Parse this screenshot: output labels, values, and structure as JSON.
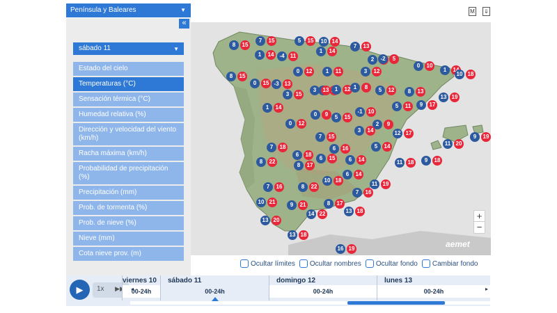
{
  "region_select": {
    "label": "Península y Baleares"
  },
  "collapse_label": "«",
  "day_select": {
    "label": "sábado 11"
  },
  "menu": [
    {
      "label": "Estado del cielo",
      "active": false
    },
    {
      "label": "Temperaturas (°C)",
      "active": true
    },
    {
      "label": "Sensación térmica (°C)",
      "active": false
    },
    {
      "label": "Humedad relativa (%)",
      "active": false
    },
    {
      "label": "Dirección y velocidad del viento (km/h)",
      "active": false
    },
    {
      "label": "Racha máxima (km/h)",
      "active": false
    },
    {
      "label": "Probabilidad de precipitación (%)",
      "active": false
    },
    {
      "label": "Precipitación (mm)",
      "active": false
    },
    {
      "label": "Prob. de tormenta (%)",
      "active": false
    },
    {
      "label": "Prob. de nieve (%)",
      "active": false
    },
    {
      "label": "Nieve (mm)",
      "active": false
    },
    {
      "label": "Cota nieve prov. (m)",
      "active": false
    }
  ],
  "top_icons": {
    "m_label": "M",
    "download_label": "⇓"
  },
  "map": {
    "colors": {
      "min": "#2d5a9f",
      "max": "#e8283a"
    },
    "logo": "aemet",
    "zoom_in": "+",
    "zoom_out": "−",
    "pairs": [
      {
        "min": "8",
        "max": "15"
      },
      {
        "min": "7",
        "max": "15"
      },
      {
        "min": "5",
        "max": "15"
      },
      {
        "min": "10",
        "max": "14"
      },
      {
        "min": "7",
        "max": "13"
      },
      {
        "min": "1",
        "max": "14"
      },
      {
        "min": "-4",
        "max": "11"
      },
      {
        "min": "1",
        "max": "14"
      },
      {
        "min": "2",
        "max": "10"
      },
      {
        "min": "-2",
        "max": "5"
      },
      {
        "min": "0",
        "max": "10"
      },
      {
        "min": "8",
        "max": "15"
      },
      {
        "min": "0",
        "max": "12"
      },
      {
        "min": "1",
        "max": "11"
      },
      {
        "min": "3",
        "max": "12"
      },
      {
        "min": "1",
        "max": "14"
      },
      {
        "min": "10",
        "max": "18"
      },
      {
        "min": "0",
        "max": "15"
      },
      {
        "min": "-3",
        "max": "13"
      },
      {
        "min": "6",
        "max": "13"
      },
      {
        "min": "3",
        "max": "15"
      },
      {
        "min": "3",
        "max": "13"
      },
      {
        "min": "1",
        "max": "12"
      },
      {
        "min": "1",
        "max": "8"
      },
      {
        "min": "5",
        "max": "12"
      },
      {
        "min": "8",
        "max": "13"
      },
      {
        "min": "13",
        "max": "19"
      },
      {
        "min": "1",
        "max": "14"
      },
      {
        "min": "5",
        "max": "11"
      },
      {
        "min": "9",
        "max": "17"
      },
      {
        "min": "0",
        "max": "9"
      },
      {
        "min": "5",
        "max": "15"
      },
      {
        "min": "-1",
        "max": "10"
      },
      {
        "min": "0",
        "max": "12"
      },
      {
        "min": "2",
        "max": "9"
      },
      {
        "min": "3",
        "max": "14"
      },
      {
        "min": "12",
        "max": "17"
      },
      {
        "min": "9",
        "max": "19"
      },
      {
        "min": "7",
        "max": "15"
      },
      {
        "min": "11",
        "max": "20"
      },
      {
        "min": "7",
        "max": "18"
      },
      {
        "min": "6",
        "max": "18"
      },
      {
        "min": "6",
        "max": "16"
      },
      {
        "min": "5",
        "max": "14"
      },
      {
        "min": "8",
        "max": "22"
      },
      {
        "min": "8",
        "max": "17"
      },
      {
        "min": "6",
        "max": "15"
      },
      {
        "min": "6",
        "max": "14"
      },
      {
        "min": "11",
        "max": "18"
      },
      {
        "min": "9",
        "max": "18"
      },
      {
        "min": "7",
        "max": "16"
      },
      {
        "min": "8",
        "max": "22"
      },
      {
        "min": "10",
        "max": "18"
      },
      {
        "min": "6",
        "max": "14"
      },
      {
        "min": "11",
        "max": "19"
      },
      {
        "min": "7",
        "max": "16"
      },
      {
        "min": "10",
        "max": "21"
      },
      {
        "min": "9",
        "max": "21"
      },
      {
        "min": "8",
        "max": "17"
      },
      {
        "min": "13",
        "max": "18"
      },
      {
        "min": "13",
        "max": "20"
      },
      {
        "min": "14",
        "max": "22"
      },
      {
        "min": "13",
        "max": "18"
      },
      {
        "min": "16",
        "max": "19"
      }
    ]
  },
  "checkboxes": [
    {
      "label": "Ocultar límites"
    },
    {
      "label": "Ocultar nombres"
    },
    {
      "label": "Ocultar fondo"
    },
    {
      "label": "Cambiar fondo"
    }
  ],
  "timeline": {
    "play_icon": "▶",
    "speed": "1x",
    "ff_icon": "▶▶",
    "left_arrow": "◂",
    "right_arrow": "▸",
    "days": [
      {
        "name": "viernes 10",
        "slot": "00-24h",
        "selected": false
      },
      {
        "name": "sábado 11",
        "slot": "00-24h",
        "selected": true
      },
      {
        "name": "domingo 12",
        "slot": "00-24h",
        "selected": false
      },
      {
        "name": "lunes 13",
        "slot": "00-24h",
        "selected": false
      }
    ]
  }
}
